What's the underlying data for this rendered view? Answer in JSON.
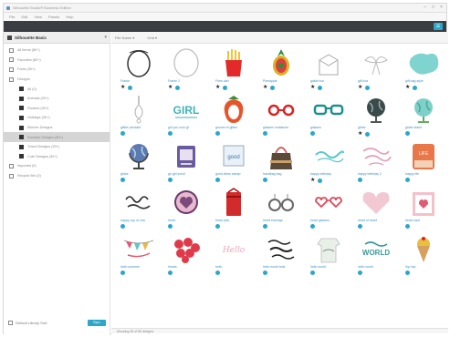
{
  "window": {
    "title": "Silhouette Studio® Business Edition"
  },
  "menu": [
    "File",
    "Edit",
    "View",
    "Panels",
    "Help"
  ],
  "sidebar": {
    "header": "Silhouette Basic",
    "items": [
      {
        "label": "All Items (80+)",
        "level": 0,
        "dark": false
      },
      {
        "label": "Favorites (80+)",
        "level": 0,
        "dark": false
      },
      {
        "label": "Fonts (30+)",
        "level": 0,
        "dark": false
      },
      {
        "label": "Designs",
        "level": 0,
        "dark": false
      },
      {
        "label": "All (0)",
        "level": 1,
        "dark": true
      },
      {
        "label": "Animals (20+)",
        "level": 1,
        "dark": true
      },
      {
        "label": "Flowers (30+)",
        "level": 1,
        "dark": true
      },
      {
        "label": "Holidays (30+)",
        "level": 1,
        "dark": true
      },
      {
        "label": "Kitchen Designs",
        "level": 1,
        "dark": true
      },
      {
        "label": "Summer Designs (80+)",
        "level": 1,
        "dark": true,
        "selected": true
      },
      {
        "label": "Travel Designs (20+)",
        "level": 1,
        "dark": true
      },
      {
        "label": "Cute Designs (30+)",
        "level": 1,
        "dark": true
      },
      {
        "label": "Imported (0)",
        "level": 0,
        "dark": false
      },
      {
        "label": "Recycle Bin (0)",
        "level": 0,
        "dark": false
      }
    ],
    "footer_label": "Default Library Sort",
    "footer_button": "Sync"
  },
  "toolbar": {
    "sort": "File Name ▾",
    "view": "Grid ▾"
  },
  "status": "Showing 35 of 80 designs",
  "grid": [
    {
      "label": "Frame",
      "star": true,
      "shape": "frame-oval"
    },
    {
      "label": "Frame 2",
      "star": true,
      "shape": "frame-round"
    },
    {
      "label": "Fries cart",
      "star": true,
      "shape": "fries"
    },
    {
      "label": "Pineapple",
      "star": true,
      "shape": "pineapple"
    },
    {
      "label": "gable box",
      "star": true,
      "shape": "box"
    },
    {
      "label": "gift box",
      "star": true,
      "shape": "bow"
    },
    {
      "label": "gift bag style",
      "star": true,
      "shape": "blob-teal"
    },
    {
      "label": "glitter pendant",
      "star": false,
      "shape": "pendant"
    },
    {
      "label": "girl you rock gl",
      "star": false,
      "shape": "girl"
    },
    {
      "label": "gnome et glitter",
      "star": false,
      "shape": "strawberry"
    },
    {
      "label": "glasses mustache",
      "star": false,
      "shape": "glasses-red"
    },
    {
      "label": "glasses",
      "star": false,
      "shape": "glasses-teal"
    },
    {
      "label": "globe",
      "star": true,
      "shape": "globe-dark"
    },
    {
      "label": "globe stand",
      "star": false,
      "shape": "globe-teal"
    },
    {
      "label": "globe",
      "star": false,
      "shape": "globe-blue"
    },
    {
      "label": "go girl scroll",
      "star": false,
      "shape": "badge"
    },
    {
      "label": "good vibes stamp",
      "star": false,
      "shape": "stamp"
    },
    {
      "label": "handbag bag",
      "star": false,
      "shape": "handbag"
    },
    {
      "label": "happy birthday",
      "star": true,
      "shape": "text-teal"
    },
    {
      "label": "happy birthday 2",
      "star": false,
      "shape": "text-pink"
    },
    {
      "label": "happy life",
      "star": false,
      "shape": "tag-orange"
    },
    {
      "label": "happy cup of cha",
      "star": false,
      "shape": "text-script"
    },
    {
      "label": "heart",
      "star": false,
      "shape": "heart-circle"
    },
    {
      "label": "heart pick",
      "star": false,
      "shape": "gift-red"
    },
    {
      "label": "heart earrings",
      "star": false,
      "shape": "earrings"
    },
    {
      "label": "heart glasses",
      "star": false,
      "shape": "heart-glasses"
    },
    {
      "label": "heart of heart",
      "star": false,
      "shape": "heart-pink"
    },
    {
      "label": "heart card",
      "star": false,
      "shape": "card-pink"
    },
    {
      "label": "hello summer",
      "star": false,
      "shape": "bunting"
    },
    {
      "label": "hearts",
      "star": false,
      "shape": "hearts-red"
    },
    {
      "label": "hello",
      "star": false,
      "shape": "text-hello"
    },
    {
      "label": "hello world bold",
      "star": false,
      "shape": "text-world"
    },
    {
      "label": "hello world",
      "star": false,
      "shape": "hello-shirt"
    },
    {
      "label": "hello world",
      "star": false,
      "shape": "text-teal-world"
    },
    {
      "label": "hip hop",
      "star": false,
      "shape": "icecream"
    }
  ]
}
